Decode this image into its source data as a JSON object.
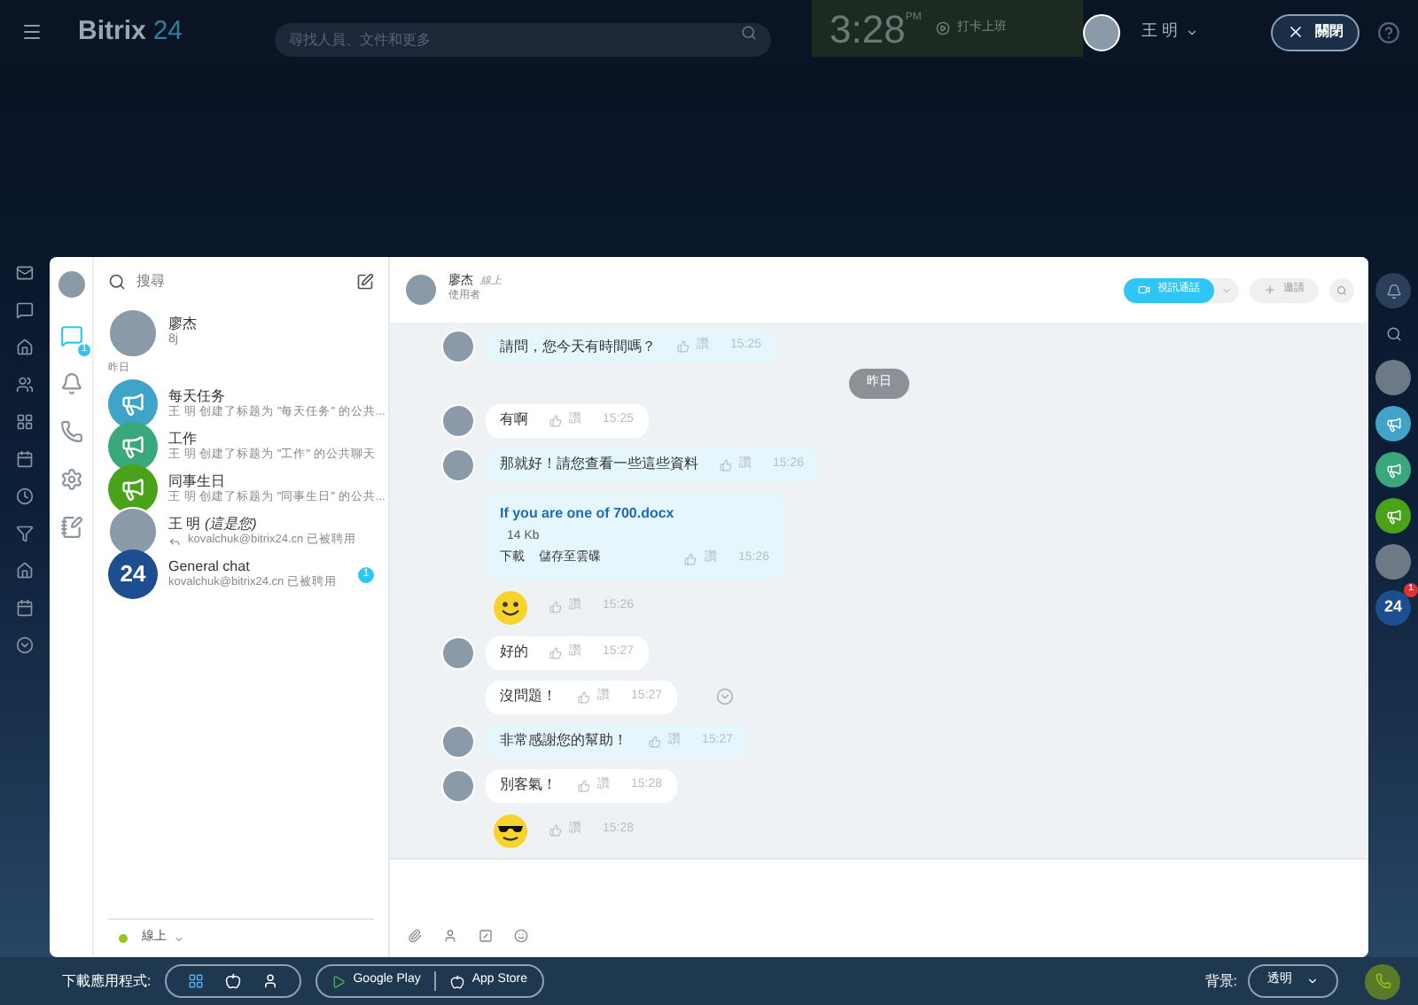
{
  "topbar": {
    "logo_main": "Bitrix",
    "logo_num": "24",
    "search_placeholder": "尋找人員、文件和更多",
    "clock": "3:28",
    "clock_suffix": "PM",
    "clock_action": "打卡上班",
    "user": "王 明",
    "close_label": "關閉"
  },
  "rail": [
    {
      "kind": "chat",
      "selected": true,
      "badge": "1"
    },
    {
      "kind": "bell",
      "selected": false
    },
    {
      "kind": "phone",
      "selected": false
    },
    {
      "kind": "gear",
      "selected": false
    },
    {
      "kind": "notes",
      "selected": false
    }
  ],
  "list": {
    "search_placeholder": "搜尋",
    "section": "昨日",
    "status": "線上",
    "pinned": {
      "name": "廖杰",
      "preview": "8j",
      "kind": "avatar"
    },
    "items": [
      {
        "name": "每天任务",
        "preview": "王 明 创建了标题为 \"每天任务\" 的公共...",
        "kind": "group",
        "color": "#3fa4c8"
      },
      {
        "name": "工作",
        "preview": "王 明 创建了标题为 \"工作\" 的公共聊天",
        "kind": "group",
        "color": "#3aa87a"
      },
      {
        "name": "同事生日",
        "preview": "王 明 创建了标题为 \"同事生日\" 的公共...",
        "kind": "group",
        "color": "#4aa21a"
      },
      {
        "name": "王 明 *(這是您)*",
        "preview": "kovalchuk@bitrix24.cn 已被聘用",
        "kind": "avatar",
        "reply": true
      },
      {
        "name": "General chat",
        "preview": "kovalchuk@bitrix24.cn 已被聘用",
        "kind": "logo",
        "logo": "24",
        "counter": "1"
      }
    ]
  },
  "chat": {
    "name": "廖杰",
    "presence": "線上",
    "role": "使用者",
    "video_call": "視訊通話",
    "invite": "邀請",
    "date_label": "昨日",
    "messages": [
      {
        "kind": "text",
        "own": true,
        "avatar": true,
        "text": "請問，您今天有時間嗎？",
        "like": "讚",
        "time": "15:25"
      },
      {
        "kind": "text",
        "own": false,
        "avatar": true,
        "text": "有啊",
        "like": "讚",
        "time": "15:25"
      },
      {
        "kind": "text",
        "own": true,
        "avatar": true,
        "text": "那就好！請您查看一些這些資料",
        "like": "讚",
        "time": "15:26"
      },
      {
        "kind": "file",
        "own": true,
        "avatar": false,
        "file": "If you are one of 700.docx",
        "size": "14 Kb",
        "actions": [
          "下載",
          "儲存至雲碟"
        ],
        "like": "讚",
        "time": "15:26"
      },
      {
        "kind": "smiley",
        "avatar": false,
        "like": "讚",
        "time": "15:26"
      },
      {
        "kind": "text",
        "own": false,
        "avatar": true,
        "text": "好的",
        "like": "讚",
        "time": "15:27"
      },
      {
        "kind": "text",
        "own": false,
        "avatar": false,
        "text": "沒問題！",
        "like": "讚",
        "time": "15:27",
        "read_mark": true
      },
      {
        "kind": "text",
        "own": true,
        "avatar": true,
        "text": "非常感謝您的幫助！",
        "like": "讚",
        "time": "15:27"
      },
      {
        "kind": "text",
        "own": false,
        "avatar": true,
        "text": "別客氣！",
        "like": "讚",
        "time": "15:28"
      },
      {
        "kind": "sunglasses",
        "avatar": false,
        "like": "讚",
        "time": "15:28"
      }
    ]
  },
  "right_rail": [
    {
      "kind": "bell"
    },
    {
      "kind": "search"
    },
    {
      "kind": "avatar"
    },
    {
      "kind": "group",
      "color": "#3fa4c8"
    },
    {
      "kind": "group",
      "color": "#3aa87a"
    },
    {
      "kind": "group",
      "color": "#4aa21a"
    },
    {
      "kind": "avatar"
    },
    {
      "kind": "logo",
      "logo": "24",
      "badge": "1"
    }
  ],
  "footer": {
    "download_label": "下載應用程式:",
    "store_buttons": [
      "Google Play",
      "App Store"
    ],
    "background_label": "背景:",
    "background_value": "透明"
  }
}
